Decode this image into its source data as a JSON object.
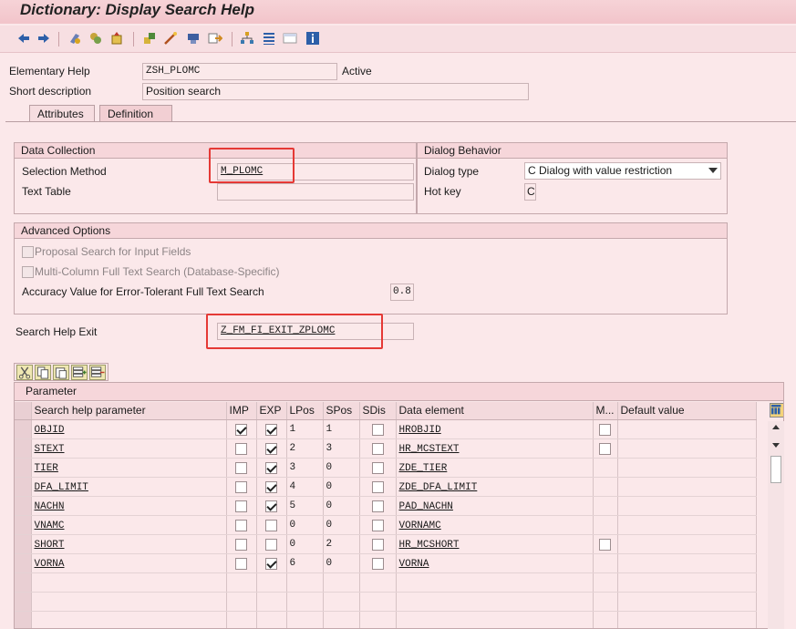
{
  "window": {
    "title": "Dictionary: Display Search Help"
  },
  "toolbar": {
    "icons": [
      "back-icon",
      "forward-icon",
      "other-object-icon",
      "display-change-icon",
      "activate-icon",
      "check-icon",
      "where-used-icon",
      "test-icon",
      "object-list-icon",
      "navigation-window-icon",
      "hierarchy-icon",
      "display-object-list-icon",
      "info-icon"
    ]
  },
  "header": {
    "elementary_help_label": "Elementary Help",
    "elementary_help_value": "ZSH_PLOMC",
    "status": "Active",
    "short_desc_label": "Short description",
    "short_desc_value": "Position search"
  },
  "tabs": [
    {
      "label": "Attributes"
    },
    {
      "label": "Definition"
    }
  ],
  "data_collection": {
    "title": "Data Collection",
    "selection_method_label": "Selection Method",
    "selection_method_value": "M_PLOMC",
    "text_table_label": "Text Table",
    "text_table_value": ""
  },
  "dialog_behavior": {
    "title": "Dialog Behavior",
    "dialog_type_label": "Dialog type",
    "dialog_type_value": "C Dialog with value restriction",
    "hot_key_label": "Hot key",
    "hot_key_value": "C"
  },
  "advanced": {
    "title": "Advanced Options",
    "proposal_label": "Proposal Search for Input Fields",
    "multicolumn_label": "Multi-Column Full Text Search (Database-Specific)",
    "accuracy_label": "Accuracy Value for Error-Tolerant Full Text Search",
    "accuracy_value": "0.8"
  },
  "exit": {
    "label": "Search Help Exit",
    "value": "Z_FM_FI_EXIT_ZPLOMC"
  },
  "parameters": {
    "title": "Parameter",
    "columns": [
      "Search help parameter",
      "IMP",
      "EXP",
      "LPos",
      "SPos",
      "SDis",
      "Data element",
      "M...",
      "Default value"
    ],
    "rows": [
      {
        "param": "OBJID",
        "imp": true,
        "exp": true,
        "lpos": "1",
        "spos": "1",
        "sdis": false,
        "element": "HROBJID",
        "m": false
      },
      {
        "param": "STEXT",
        "imp": false,
        "exp": true,
        "lpos": "2",
        "spos": "3",
        "sdis": false,
        "element": "HR_MCSTEXT",
        "m": false
      },
      {
        "param": "TIER",
        "imp": false,
        "exp": true,
        "lpos": "3",
        "spos": "0",
        "sdis": false,
        "element": "ZDE_TIER",
        "m": null
      },
      {
        "param": "DFA_LIMIT",
        "imp": false,
        "exp": true,
        "lpos": "4",
        "spos": "0",
        "sdis": false,
        "element": "ZDE_DFA_LIMIT",
        "m": null
      },
      {
        "param": "NACHN",
        "imp": false,
        "exp": true,
        "lpos": "5",
        "spos": "0",
        "sdis": false,
        "element": "PAD_NACHN",
        "m": null
      },
      {
        "param": "VNAMC",
        "imp": false,
        "exp": false,
        "lpos": "0",
        "spos": "0",
        "sdis": false,
        "element": "VORNAMC",
        "m": null
      },
      {
        "param": "SHORT",
        "imp": false,
        "exp": false,
        "lpos": "0",
        "spos": "2",
        "sdis": false,
        "element": "HR_MCSHORT",
        "m": false
      },
      {
        "param": "VORNA",
        "imp": false,
        "exp": true,
        "lpos": "6",
        "spos": "0",
        "sdis": false,
        "element": "VORNA",
        "m": null
      }
    ]
  }
}
